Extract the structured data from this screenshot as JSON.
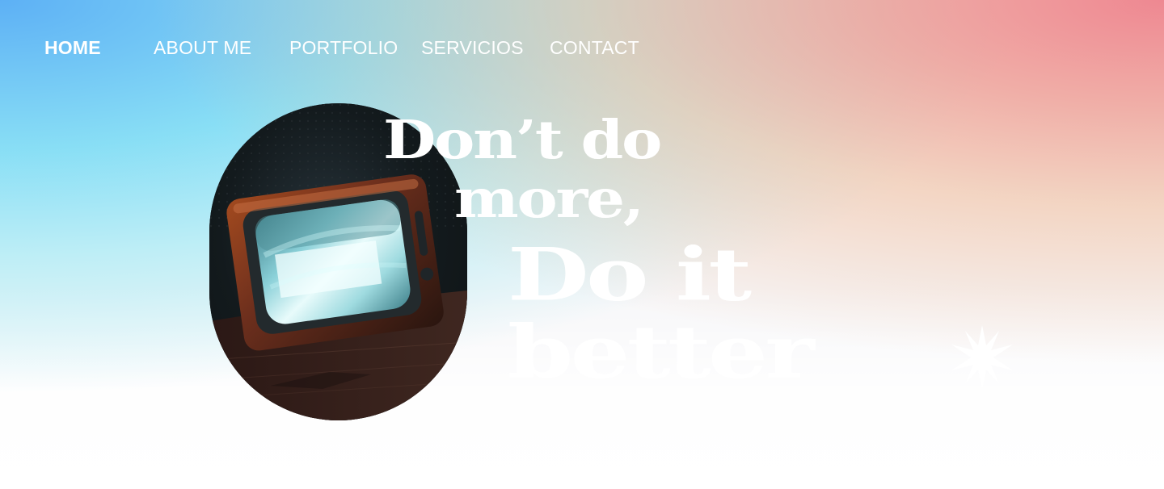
{
  "colors": {
    "nav_text": "#ffffff",
    "headline_text": "#ffffff",
    "sparkle_fill": "#ffffff",
    "gradient_left": "#71bff3",
    "gradient_mid_cyan": "#99e8f4",
    "gradient_right_pink": "#ea8d95",
    "gradient_right_peach": "#efbc95",
    "page_bottom": "#ffffff"
  },
  "nav": {
    "items": [
      {
        "label": "HOME",
        "active": true
      },
      {
        "label": "ABOUT ME",
        "active": false
      },
      {
        "label": "PORTFOLIO",
        "active": false
      },
      {
        "label": "SERVICIOS",
        "active": false
      },
      {
        "label": "CONTACT",
        "active": false
      }
    ]
  },
  "hero": {
    "image_name": "retro-tv-image",
    "headline_lines": [
      "Don’t do",
      "more,",
      "Do it",
      "better"
    ],
    "decorative_icon": "sparkle-icon"
  }
}
